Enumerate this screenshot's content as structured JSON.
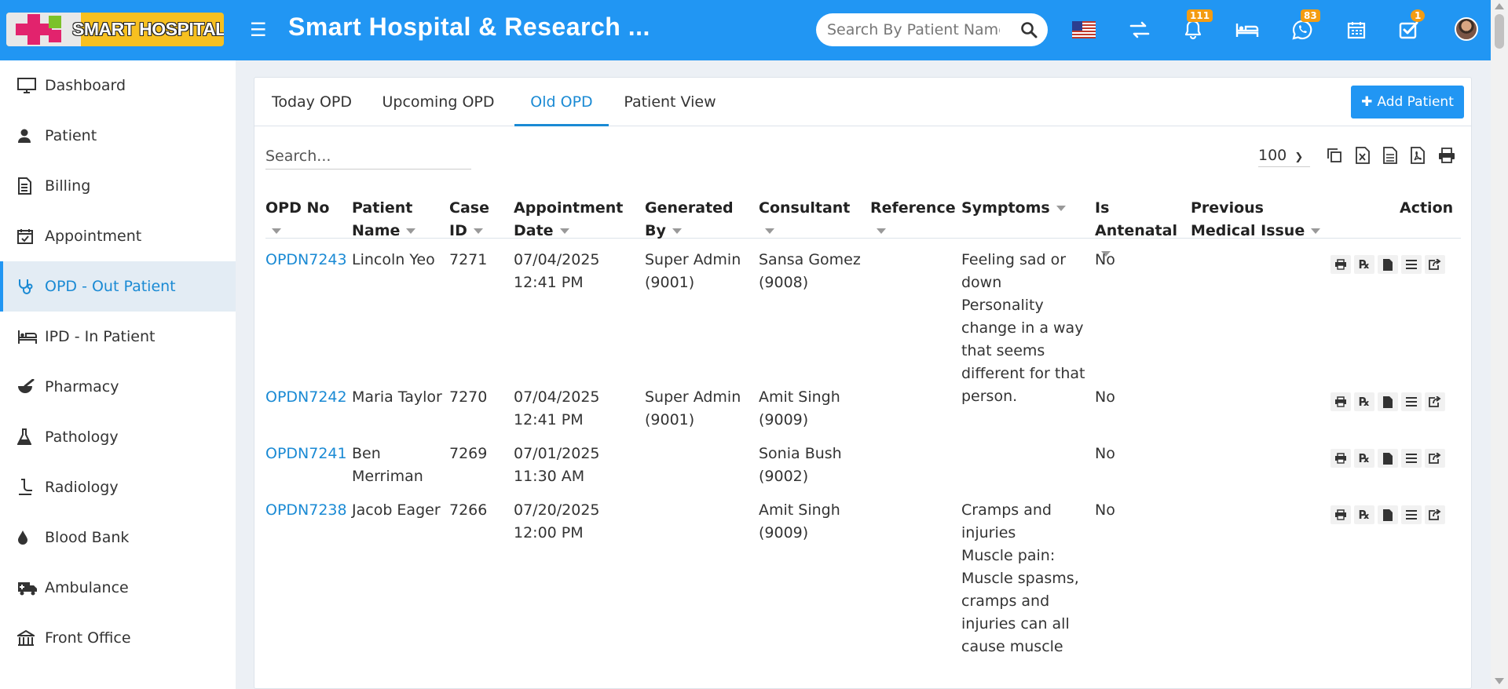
{
  "header": {
    "logo_text": "SMART HOSPITAL",
    "app_title": "Smart Hospital & Research ...",
    "search_placeholder": "Search By Patient Name",
    "notifications_count": "111",
    "whatsapp_count": "83",
    "tasks_count": "1"
  },
  "colors": {
    "brand": "#2196f3",
    "link": "#1a8ad4",
    "badge": "#f39c12",
    "sidebar_active_bg": "#e3ecf4"
  },
  "sidebar": {
    "items": [
      {
        "label": "Dashboard",
        "icon": "monitor-icon"
      },
      {
        "label": "Patient",
        "icon": "user-icon"
      },
      {
        "label": "Billing",
        "icon": "invoice-icon"
      },
      {
        "label": "Appointment",
        "icon": "calendar-check-icon"
      },
      {
        "label": "OPD - Out Patient",
        "icon": "stethoscope-icon",
        "active": true
      },
      {
        "label": "IPD - In Patient",
        "icon": "hospital-bed-icon"
      },
      {
        "label": "Pharmacy",
        "icon": "mortar-pestle-icon"
      },
      {
        "label": "Pathology",
        "icon": "flask-icon"
      },
      {
        "label": "Radiology",
        "icon": "xray-icon"
      },
      {
        "label": "Blood Bank",
        "icon": "blood-drop-icon"
      },
      {
        "label": "Ambulance",
        "icon": "ambulance-icon"
      },
      {
        "label": "Front Office",
        "icon": "front-office-icon"
      }
    ]
  },
  "tabs": [
    "Today OPD",
    "Upcoming OPD",
    "Old OPD",
    "Patient View"
  ],
  "active_tab": "Old OPD",
  "add_patient_label": "Add Patient",
  "table": {
    "search_placeholder": "Search...",
    "page_length": "100",
    "export_tools": [
      "copy-icon",
      "excel-icon",
      "csv-icon",
      "pdf-icon",
      "print-icon"
    ],
    "columns": [
      {
        "label": "OPD No"
      },
      {
        "label": "Patient Name"
      },
      {
        "label": "Case ID"
      },
      {
        "label": "Appointment Date"
      },
      {
        "label": "Generated By"
      },
      {
        "label": "Consultant"
      },
      {
        "label": "Reference"
      },
      {
        "label": "Symptoms"
      },
      {
        "label": "Is Antenatal"
      },
      {
        "label": "Previous Medical Issue"
      },
      {
        "label": "Action"
      }
    ],
    "rows": [
      {
        "opd_no": "OPDN7243",
        "patient_name": "Lincoln Yeo",
        "case_id": "7271",
        "date": "07/04/2025",
        "time": "12:41 PM",
        "generated_by": "Super Admin",
        "generated_by_id": "(9001)",
        "consultant": "Sansa Gomez",
        "consultant_id": "(9008)",
        "reference": "",
        "symptoms": [
          "Feeling sad or",
          "down",
          "Personality",
          "change in a way",
          "that seems",
          "different for that",
          "person."
        ],
        "antenatal": "No",
        "previous_issue": ""
      },
      {
        "opd_no": "OPDN7242",
        "patient_name": "Maria Taylor",
        "case_id": "7270",
        "date": "07/04/2025",
        "time": "12:41 PM",
        "generated_by": "Super Admin",
        "generated_by_id": "(9001)",
        "consultant": "Amit Singh",
        "consultant_id": "(9009)",
        "reference": "",
        "symptoms": [],
        "antenatal": "No",
        "previous_issue": ""
      },
      {
        "opd_no": "OPDN7241",
        "patient_name": "Ben",
        "patient_name_2": "Merriman",
        "case_id": "7269",
        "date": "07/01/2025",
        "time": "11:30 AM",
        "generated_by": "",
        "generated_by_id": "",
        "consultant": "Sonia Bush",
        "consultant_id": "(9002)",
        "reference": "",
        "symptoms": [],
        "antenatal": "No",
        "previous_issue": ""
      },
      {
        "opd_no": "OPDN7238",
        "patient_name": "Jacob Eager",
        "case_id": "7266",
        "date": "07/20/2025",
        "time": "12:00 PM",
        "generated_by": "",
        "generated_by_id": "",
        "consultant": "Amit Singh",
        "consultant_id": "(9009)",
        "reference": "",
        "symptoms": [
          "Cramps and",
          "injuries",
          "Muscle pain:",
          "Muscle spasms,",
          "cramps and",
          "injuries can all",
          "cause muscle"
        ],
        "antenatal": "No",
        "previous_issue": ""
      }
    ],
    "row_actions": [
      "print-icon",
      "prescription-icon",
      "document-icon",
      "list-icon",
      "share-icon"
    ]
  }
}
